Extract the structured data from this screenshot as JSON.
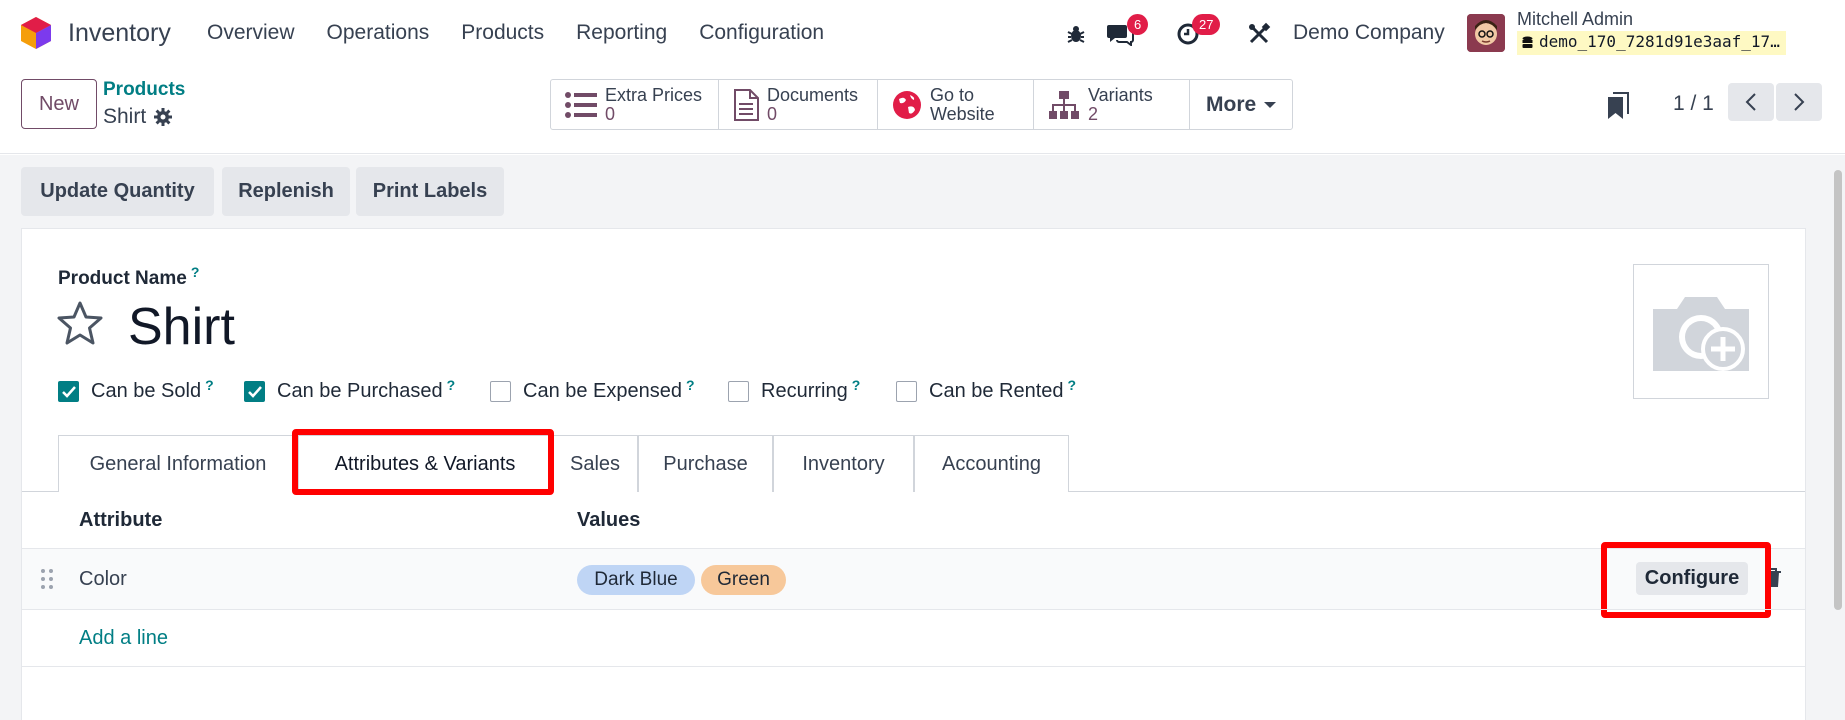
{
  "navbar": {
    "app_title": "Inventory",
    "menu": [
      "Overview",
      "Operations",
      "Products",
      "Reporting",
      "Configuration"
    ],
    "messages_count": "6",
    "activities_count": "27",
    "company": "Demo Company",
    "user_name": "Mitchell Admin",
    "database": "demo_170_7281d91e3aaf_17…",
    "icons": [
      "bug-icon",
      "chat-icon",
      "clock-icon",
      "tools-icon"
    ]
  },
  "control": {
    "new_label": "New",
    "breadcrumb_parent": "Products",
    "breadcrumb_current": "Shirt",
    "smart_buttons": [
      {
        "label": "Extra Prices",
        "value": "0"
      },
      {
        "label": "Documents",
        "value": "0"
      },
      {
        "label": "Go to",
        "value": "Website"
      },
      {
        "label": "Variants",
        "value": "2"
      }
    ],
    "more_label": "More",
    "pager": "1 / 1"
  },
  "actions": {
    "update_quantity": "Update Quantity",
    "replenish": "Replenish",
    "print_labels": "Print Labels"
  },
  "form": {
    "product_name_label": "Product Name",
    "help_mark": "?",
    "product_name": "Shirt",
    "checkboxes": [
      {
        "label": "Can be Sold",
        "checked": true
      },
      {
        "label": "Can be Purchased",
        "checked": true
      },
      {
        "label": "Can be Expensed",
        "checked": false
      },
      {
        "label": "Recurring",
        "checked": false
      },
      {
        "label": "Can be Rented",
        "checked": false
      }
    ],
    "tabs": [
      "General Information",
      "Attributes & Variants",
      "Sales",
      "Purchase",
      "Inventory",
      "Accounting"
    ],
    "active_tab": "Attributes & Variants"
  },
  "attributes_table": {
    "headers": [
      "Attribute",
      "Values"
    ],
    "rows": [
      {
        "attribute": "Color",
        "values": [
          "Dark Blue",
          "Green"
        ]
      }
    ],
    "configure_label": "Configure",
    "add_line_label": "Add a line"
  },
  "colors": {
    "brand": "#714b67",
    "link": "#017e84",
    "tag_dark_blue": "#bfd5f5",
    "tag_green": "#f7c89a",
    "highlight": "#ff0000"
  }
}
